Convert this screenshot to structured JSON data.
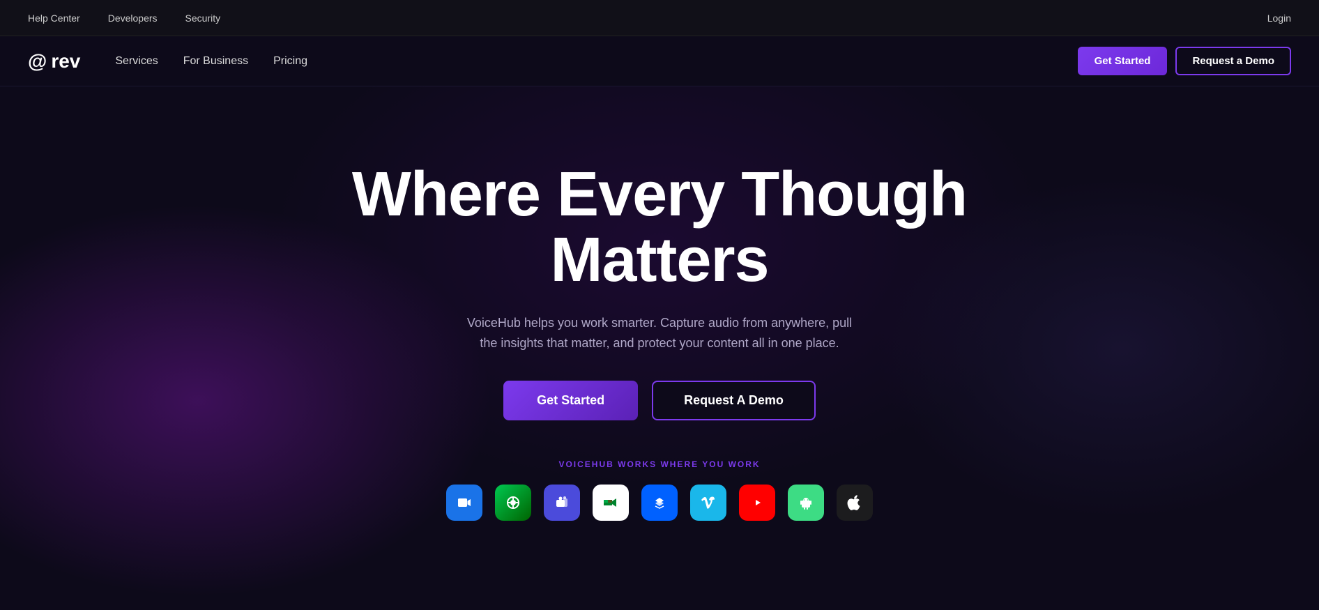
{
  "topbar": {
    "links": [
      {
        "label": "Help Center",
        "name": "help-center-link"
      },
      {
        "label": "Developers",
        "name": "developers-link"
      },
      {
        "label": "Security",
        "name": "security-link"
      }
    ],
    "login_label": "Login"
  },
  "navbar": {
    "logo_text": "rev",
    "logo_icon": "@",
    "nav_links": [
      {
        "label": "Services",
        "name": "services-link"
      },
      {
        "label": "For Business",
        "name": "for-business-link"
      },
      {
        "label": "Pricing",
        "name": "pricing-link"
      }
    ],
    "get_started_label": "Get Started",
    "request_demo_label": "Request a Demo"
  },
  "hero": {
    "title": "Where Every Though Matters",
    "subtitle": "VoiceHub helps you work smarter. Capture audio from anywhere, pull the insights that matter, and protect your content all in one place.",
    "btn_primary_label": "Get Started",
    "btn_secondary_label": "Request A Demo",
    "works_label": "VOICEHUB WORKS WHERE YOU WORK",
    "integrations": [
      {
        "name": "zoom",
        "icon": "🎥",
        "css_class": "icon-zoom"
      },
      {
        "name": "webex",
        "icon": "🌐",
        "css_class": "icon-webex"
      },
      {
        "name": "teams",
        "icon": "👥",
        "css_class": "icon-teams"
      },
      {
        "name": "meet",
        "icon": "📹",
        "css_class": "icon-meet"
      },
      {
        "name": "dropbox",
        "icon": "📦",
        "css_class": "icon-dropbox"
      },
      {
        "name": "vimeo",
        "icon": "▶",
        "css_class": "icon-vimeo"
      },
      {
        "name": "youtube",
        "icon": "▶",
        "css_class": "icon-youtube"
      },
      {
        "name": "android",
        "icon": "🤖",
        "css_class": "icon-android"
      },
      {
        "name": "apple",
        "icon": "🍎",
        "css_class": "icon-apple"
      }
    ]
  },
  "colors": {
    "accent": "#7c3aed",
    "bg": "#0d0a1a"
  }
}
